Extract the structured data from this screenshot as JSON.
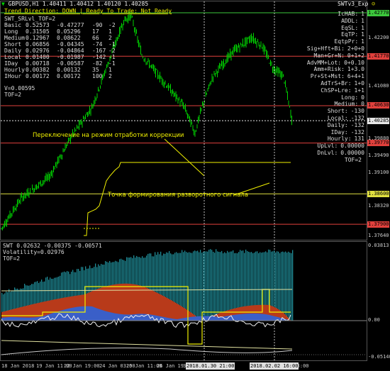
{
  "window": {
    "title": "GBPUSD,H1  1.40411 1.40412 1.40120 1.40285",
    "ea_name": "SWTv3_Exp",
    "ea_icon": "smiley-icon"
  },
  "trend": {
    "direction_label": "Trend Direction:",
    "direction_value": "DOWN",
    "ready_label": "Ready To Trade:",
    "ready_value": "Not Ready"
  },
  "indicator_name": "SWT_SRLvl_TOF=2",
  "info_table": [
    {
      "name": "Basic",
      "v1": "0.52573",
      "v2": "-0.47277",
      "v3": "-90",
      "v4": "-2"
    },
    {
      "name": "Long",
      "v1": "0.31505",
      "v2": "0.05296",
      "v3": "17",
      "v4": "1"
    },
    {
      "name": "Medium",
      "v1": "0.12967",
      "v2": "0.08622",
      "v3": "66",
      "v4": "2"
    },
    {
      "name": "Short",
      "v1": "0.06856",
      "v2": "-0.04345",
      "v3": "-74",
      "v4": "-1"
    },
    {
      "name": "Daily",
      "v1": "0.02976",
      "v2": "-0.04864",
      "v3": "-167",
      "v4": "-2"
    },
    {
      "name": "Local",
      "v1": "0.01400",
      "v2": "-0.01987",
      "v3": "-142",
      "v4": "-1"
    },
    {
      "name": "IDay",
      "v1": "0.00718",
      "v2": "-0.00587",
      "v3": "-82",
      "v4": "-1"
    },
    {
      "name": "Hourly",
      "v1": "0.00382",
      "v2": "0.00132",
      "v3": "35",
      "v4": "1"
    },
    {
      "name": "IHour",
      "v1": "0.00172",
      "v2": "0.00172",
      "v3": "100",
      "v4": "2"
    }
  ],
  "v_value": "V=0.00595",
  "tof": "TOF=2",
  "right_panel": [
    {
      "label": "IcHAB:",
      "value": "1"
    },
    {
      "label": "ADDL:",
      "value": "1"
    },
    {
      "label": "EqSL:",
      "value": "1"
    },
    {
      "label": "EqTP:",
      "value": "1"
    },
    {
      "label": "EqtpPr:",
      "value": "1"
    },
    {
      "label": "Sig+Hft+Bi:",
      "value": "2+0+0"
    },
    {
      "label": "Man+Gr+N:",
      "value": "0+1+2"
    },
    {
      "label": "AdvMM+Lot:",
      "value": "0+0.10"
    },
    {
      "label": "Amm+Risk:",
      "value": "1+3.0"
    },
    {
      "label": "Pr+St+Mst:",
      "value": "6+4+1"
    },
    {
      "label": "AdTrS+Br:",
      "value": "1+0"
    },
    {
      "label": "ChSP+Lre:",
      "value": "1+1"
    },
    {
      "label": "Long:",
      "value": "0"
    },
    {
      "label": "Medium:",
      "value": "0"
    },
    {
      "label": "Short:",
      "value": "-130"
    },
    {
      "label": "Local:",
      "value": "-132"
    },
    {
      "label": "Daily:",
      "value": "-132"
    },
    {
      "label": "IDay:",
      "value": "-132"
    },
    {
      "label": "Hourly:",
      "value": "131"
    },
    {
      "label": "UpLvl:",
      "value": "0.00000"
    },
    {
      "label": "DnLvl:",
      "value": "0.00000"
    },
    {
      "label": "TOF=2",
      "value": ""
    }
  ],
  "price_axis": [
    "1.42770",
    "1.42200",
    "1.41730",
    "1.41080",
    "1.40285",
    "1.39880",
    "1.39490",
    "1.39100",
    "1.38600",
    "1.38320",
    "1.37900",
    "1.37640"
  ],
  "price_tags": [
    {
      "value": "1.42770",
      "color": "#3cc83c"
    },
    {
      "value": "1.41770",
      "color": "#e0403c"
    },
    {
      "value": "1.40630",
      "color": "#e0403c"
    },
    {
      "value": "1.40285",
      "color": "#e6e6e6"
    },
    {
      "value": "1.39770",
      "color": "#e0403c"
    },
    {
      "value": "1.38600",
      "color": "#e0e040"
    },
    {
      "value": "1.37900",
      "color": "#e0403c"
    }
  ],
  "annotations": {
    "correction": "Переключение на режим отработки коррекции",
    "reversal": "Точка формирования разворотного сигнала"
  },
  "sub_window": {
    "title": "SWT 0.02632 -0.00375 -0.00571",
    "volatility": "Volatility=0.02976",
    "tof": "TOF=2",
    "axis_top": "0.03813",
    "axis_mid": "0.00",
    "axis_bottom": "-0.05140"
  },
  "time_axis": {
    "labels": [
      "18 Jan 2018",
      "19 Jan 11:00",
      "22 Jan 19:00",
      "24 Jan 03:00",
      "25 Jan 11:00",
      "26 Jan 19:00",
      "30 Jan 03:00",
      "1 Feb 19:00",
      "b 03:00"
    ],
    "highlights": [
      "2018.01.30 21:00",
      "2018.02.02 16:00"
    ]
  },
  "colors": {
    "bull_candle": "#00d200",
    "bear_candle": "#00d200",
    "teal_area": "#1f8a96",
    "red_area": "#b83a1a",
    "blue_area": "#3a5fc8",
    "yellow_line": "#f0f000"
  }
}
